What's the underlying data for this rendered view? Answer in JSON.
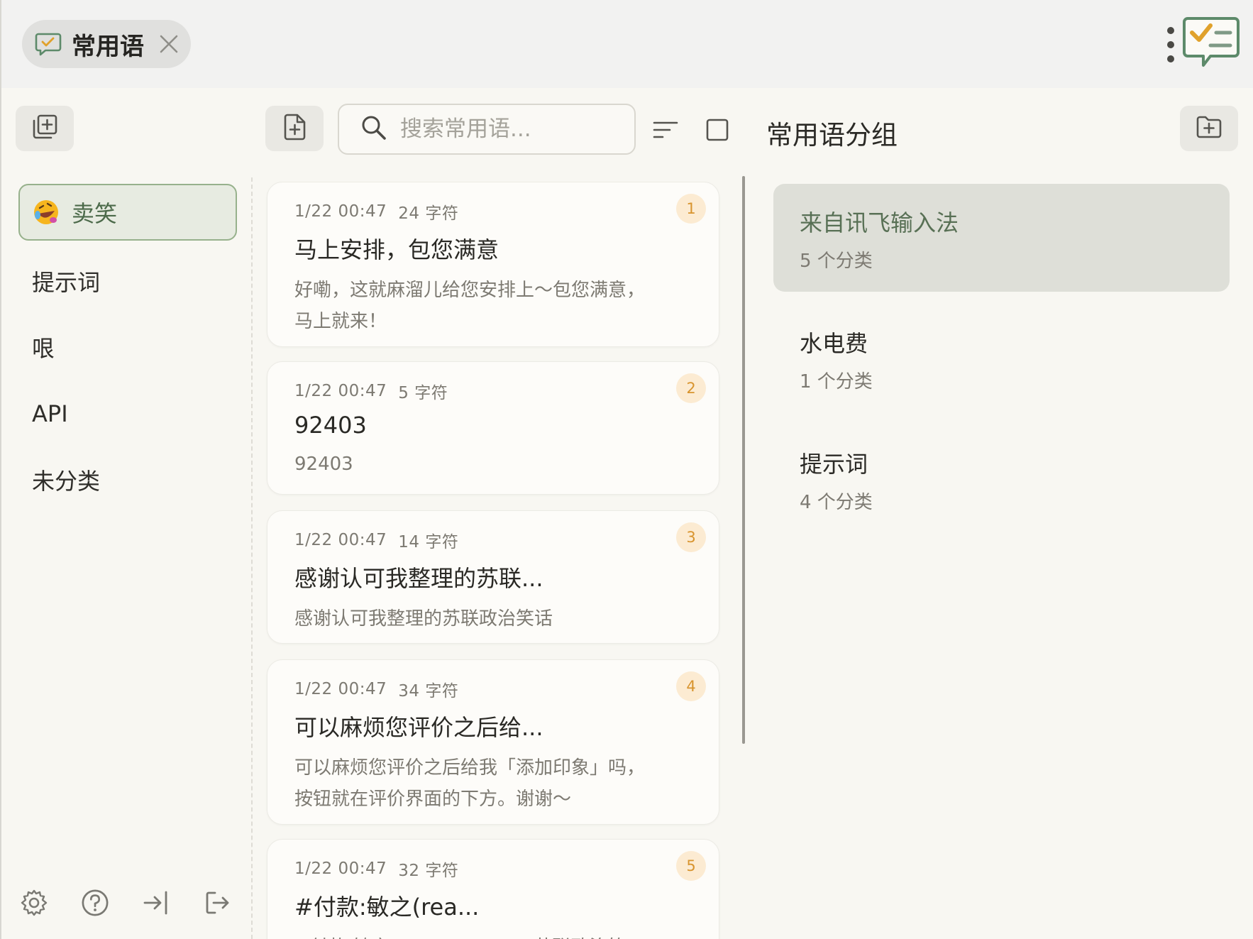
{
  "tab": {
    "title": "常用语"
  },
  "search": {
    "placeholder": "搜索常用语..."
  },
  "categories": [
    {
      "label": "卖笑",
      "emoji": "rolling-on-floor-laughing-emoji",
      "selected": true
    },
    {
      "label": "提示词"
    },
    {
      "label": "哏"
    },
    {
      "label": "API"
    },
    {
      "label": "未分类"
    }
  ],
  "phrases": [
    {
      "date": "1/22 00:47",
      "chars": "24 字符",
      "title": "马上安排，包您满意",
      "body": "好嘞，这就麻溜儿给您安排上～包您满意，\n马上就来！",
      "index": "1"
    },
    {
      "date": "1/22 00:47",
      "chars": "5 字符",
      "title": "92403",
      "body": "92403",
      "index": "2"
    },
    {
      "date": "1/22 00:47",
      "chars": "14 字符",
      "title": "感谢认可我整理的苏联...",
      "body": "感谢认可我整理的苏联政治笑话",
      "index": "3"
    },
    {
      "date": "1/22 00:47",
      "chars": "34 字符",
      "title": "可以麻烦您评价之后给...",
      "body": "可以麻烦您评价之后给我「添加印象」吗，\n按钮就在评价界面的下方。谢谢～",
      "index": "4"
    },
    {
      "date": "1/22 00:47",
      "chars": "32 字符",
      "title": "#付款:敏之(rea...",
      "body": "#付款:敏之(realSilenYang)/苏联政治笑",
      "index": "5"
    }
  ],
  "groups_panel": {
    "title": "常用语分组",
    "groups": [
      {
        "name": "来自讯飞输入法",
        "count": "5 个分类",
        "selected": true
      },
      {
        "name": "水电费",
        "count": "1 个分类"
      },
      {
        "name": "提示词",
        "count": "4 个分类"
      }
    ]
  },
  "colors": {
    "accent_green": "#97b18c",
    "badge_bg": "#fcebd2",
    "badge_text": "#d8942e",
    "logo_orange": "#e0a12b",
    "logo_green": "#5d8a6a"
  },
  "icons": {
    "tab": "chat-bubble-icon",
    "close": "close-icon",
    "menu": "more-vertical-icon",
    "add_category": "add-stack-icon",
    "add_phrase": "add-file-icon",
    "search": "search-icon",
    "sort": "sort-icon",
    "select": "checkbox-icon",
    "add_group": "add-folder-icon",
    "settings": "gear-icon",
    "help": "help-icon",
    "import": "import-icon",
    "export": "export-icon"
  }
}
